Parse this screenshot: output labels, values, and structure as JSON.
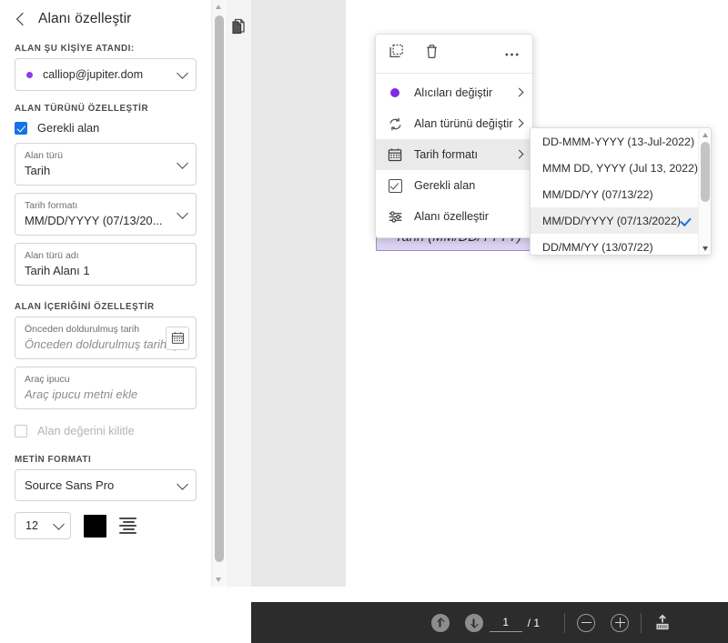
{
  "left_panel": {
    "title": "Alanı özelleştir",
    "back_icon": "chevron-left-icon",
    "assigned_section_label": "ALAN ŞU KİŞİYE ATANDI:",
    "assignee": "calliop@jupiter.dom",
    "assignee_dot_color": "#8b3cf0",
    "field_type_section_label": "ALAN TÜRÜNÜ ÖZELLEŞTİR",
    "required_checkbox": {
      "label": "Gerekli alan",
      "checked": true,
      "color": "#1473e6"
    },
    "field_type": {
      "label": "Alan türü",
      "value": "Tarih"
    },
    "date_format": {
      "label": "Tarih formatı",
      "value": "MM/DD/YYYY (07/13/20..."
    },
    "field_name": {
      "label": "Alan türü adı",
      "value": "Tarih Alanı 1"
    },
    "content_section_label": "ALAN İÇERİĞİNİ ÖZELLEŞTİR",
    "prefilled_date": {
      "label": "Önceden doldurulmuş tarih",
      "placeholder": "Önceden doldurulmuş tarihi girin"
    },
    "tooltip": {
      "label": "Araç ipucu",
      "placeholder": "Araç ipucu metni ekle"
    },
    "lock_checkbox": {
      "label": "Alan değerini kilitle",
      "checked": false
    },
    "text_format_section_label": "METİN FORMATI",
    "font_family": "Source Sans Pro",
    "font_size": "12",
    "font_color": "#000000"
  },
  "context_menu": {
    "toolbar": {
      "duplicate_icon": "duplicate-field-icon",
      "delete_icon": "trash-icon",
      "more_icon": "more-options-icon"
    },
    "items": [
      {
        "icon": "recipient-dot-icon",
        "label": "Alıcıları değiştir",
        "has_submenu": true,
        "active": false
      },
      {
        "icon": "refresh-icon",
        "label": "Alan türünü değiştir",
        "has_submenu": true,
        "active": false
      },
      {
        "icon": "calendar-icon",
        "label": "Tarih formatı",
        "has_submenu": true,
        "active": true
      },
      {
        "icon": "checkbox-icon",
        "label": "Gerekli alan",
        "has_submenu": false,
        "active": false
      },
      {
        "icon": "sliders-icon",
        "label": "Alanı özelleştir",
        "has_submenu": false,
        "active": false
      }
    ]
  },
  "format_submenu": {
    "options": [
      {
        "label": "DD-MMM-YYYY (13-Jul-2022)",
        "selected": false
      },
      {
        "label": "MMM DD, YYYY (Jul 13, 2022)",
        "selected": false
      },
      {
        "label": "MM/DD/YY (07/13/22)",
        "selected": false
      },
      {
        "label": "MM/DD/YYYY (07/13/2022)",
        "selected": true
      },
      {
        "label": "DD/MM/YY (13/07/22)",
        "selected": false
      }
    ]
  },
  "document": {
    "page_thumb_icon": "pages-icon",
    "field_pill": {
      "required_marker": "*",
      "label": "Tarih (MM/DD/YYYY)",
      "fill": "#ddd3f2",
      "border": "#9a8ec0"
    }
  },
  "bottom_toolbar": {
    "prev_page_icon": "arrow-up-circle-icon",
    "next_page_icon": "arrow-down-circle-icon",
    "page_number": "1",
    "page_total": "/ 1",
    "zoom_out_icon": "minus-circle-icon",
    "zoom_in_icon": "plus-circle-icon",
    "upload_icon": "upload-tray-icon"
  }
}
